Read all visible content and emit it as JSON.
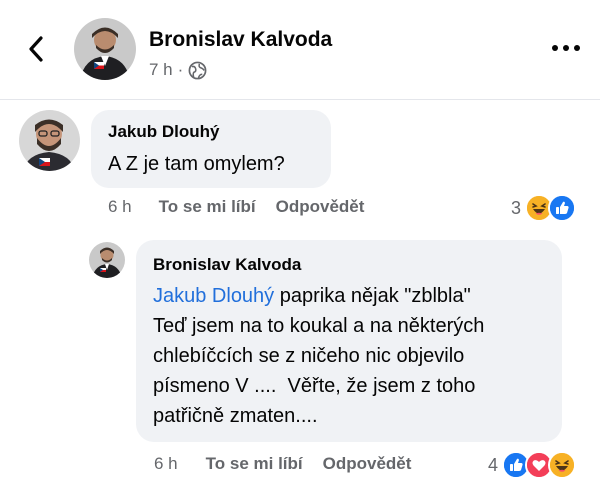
{
  "header": {
    "back_icon": "chevron-left-icon",
    "author": "Bronislav Kalvoda",
    "time": "7 h",
    "separator": "·",
    "visibility_icon": "globe-icon",
    "more_icon": "more-horizontal-icon"
  },
  "comments": [
    {
      "author": "Jakub Dlouhý",
      "text": "A Z je tam omylem?",
      "time": "6 h",
      "like_label": "To se mi líbí",
      "reply_label": "Odpovědět",
      "reaction_count": "3",
      "reactions": [
        "haha-icon",
        "like-icon"
      ]
    },
    {
      "author": "Bronislav Kalvoda",
      "mention": "Jakub Dlouhý",
      "lines": [
        " paprika nějak \"zblbla\"",
        "Teď jsem na to koukal a na některých",
        "chlebíčcích se z ničeho nic objevilo",
        "písmeno V ....  Věřte, že jsem z toho",
        "patřičně zmaten...."
      ],
      "time": "6 h",
      "like_label": "To se mi líbí",
      "reply_label": "Odpovědět",
      "reaction_count": "4",
      "reactions": [
        "like-icon",
        "love-icon",
        "haha-icon"
      ]
    }
  ],
  "colors": {
    "mention": "#216fdb",
    "bubble": "#f0f2f5",
    "secondary_text": "#65676b",
    "like": "#1877f2",
    "love": "#f33e58",
    "haha": "#f7b125"
  }
}
